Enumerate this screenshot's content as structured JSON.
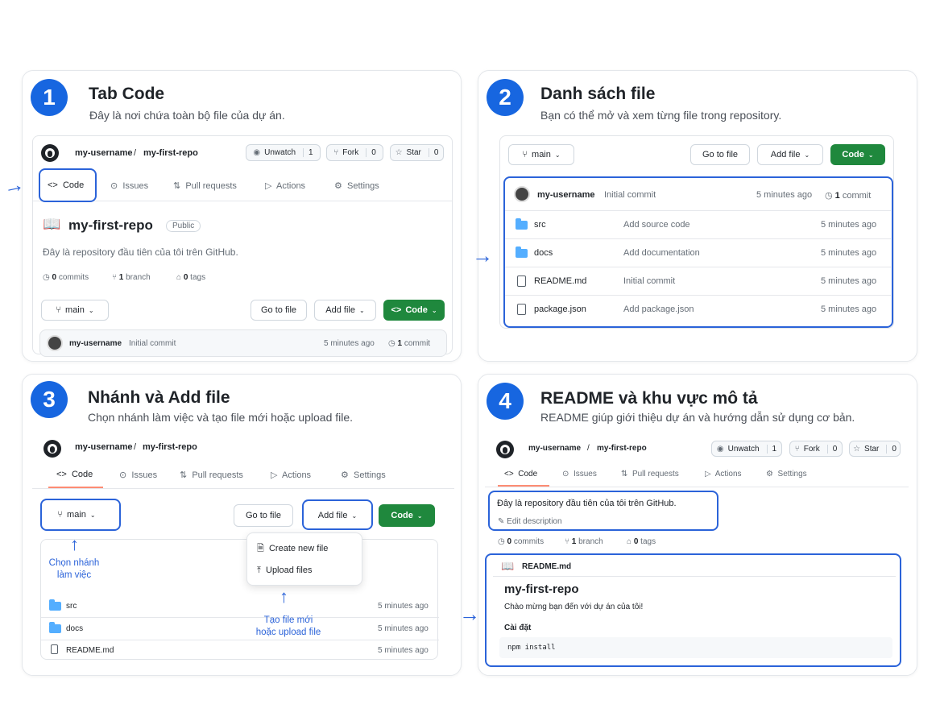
{
  "panels": [
    {
      "num": "1",
      "title": "Tab Code",
      "subtitle": "Đây là nơi chứa toàn bộ file của dự án."
    },
    {
      "num": "2",
      "title": "Danh sách file",
      "subtitle": "Bạn có thể mở và xem từng file trong repository."
    },
    {
      "num": "3",
      "title": "Nhánh và Add file",
      "subtitle": "Chọn nhánh làm việc và tạo file mới hoặc upload file."
    },
    {
      "num": "4",
      "title": "README và khu vực mô tả",
      "subtitle": "README giúp giới thiệu dự án và hướng dẫn sử dụng cơ bản."
    }
  ],
  "repo": {
    "owner": "my-username",
    "sep": "/",
    "name": "my-first-repo",
    "visibility": "Public",
    "description": "Đây là repository đầu tiên của tôi trên GitHub.",
    "edit_description": "Edit description",
    "watch_label": "Unwatch",
    "watch_count": "1",
    "fork_label": "Fork",
    "fork_count": "0",
    "star_label": "Star",
    "star_count": "0"
  },
  "tabs": {
    "code": "Code",
    "issues": "Issues",
    "pulls": "Pull requests",
    "actions": "Actions",
    "settings": "Settings"
  },
  "stats": {
    "commits": "0",
    "commits_label": "commits",
    "branches": "1",
    "branches_label": "branch",
    "tags": "0",
    "tags_label": "tags"
  },
  "toolbar": {
    "branch": "main",
    "go_to_file": "Go to file",
    "add_file": "Add file",
    "code": "Code"
  },
  "commit": {
    "author": "my-username",
    "message": "Initial commit",
    "time": "5 minutes ago",
    "count": "1",
    "count_label": "commit"
  },
  "files": [
    {
      "name": "src",
      "type": "folder",
      "message": "Add source code",
      "time": "5 minutes ago"
    },
    {
      "name": "docs",
      "type": "folder",
      "message": "Add documentation",
      "time": "5 minutes ago"
    },
    {
      "name": "README.md",
      "type": "file",
      "message": "Initial commit",
      "time": "5 minutes ago"
    },
    {
      "name": "package.json",
      "type": "file",
      "message": "Add package.json",
      "time": "5 minutes ago"
    }
  ],
  "add_file_menu": {
    "create": "Create new file",
    "upload": "Upload files"
  },
  "notes": {
    "branch_line1": "Chọn nhánh",
    "branch_line2": "làm việc",
    "addfile_line1": "Tạo file mới",
    "addfile_line2": "hoặc upload file"
  },
  "readme": {
    "filename": "README.md",
    "heading": "my-first-repo",
    "intro": "Chào mừng bạn đến với dự án của tôi!",
    "section": "Cài đặt",
    "code": "npm install"
  },
  "arrow_glyph": "→",
  "up_arrow_glyph": "↑",
  "colors": {
    "accent_blue": "#2b63d9",
    "badge_blue": "#1766e0",
    "green": "#1f883d",
    "tab_underline": "#fd8c73"
  }
}
